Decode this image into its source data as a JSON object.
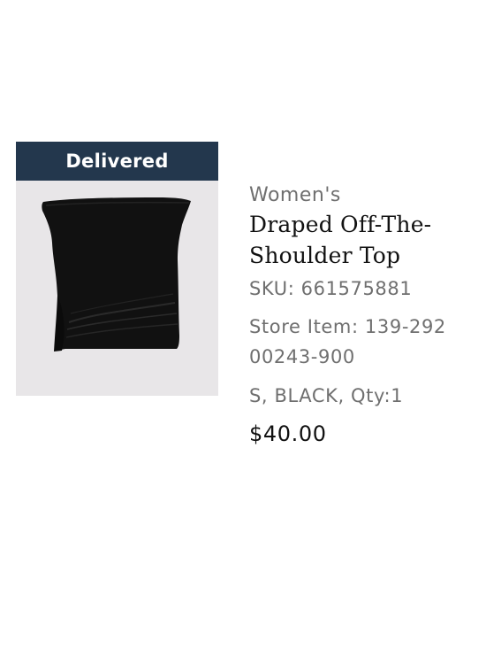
{
  "order_item": {
    "status": "Delivered",
    "category": "Women's",
    "product_name": "Draped Off-The-Shoulder Top",
    "sku": "SKU: 661575881",
    "store_item_line1": "Store Item: 139-292",
    "store_item_line2": "00243-900",
    "variant": "S, BLACK, Qty:1",
    "price": "$40.00"
  },
  "colors": {
    "status_banner_bg": "#23374d",
    "image_bg": "#e8e6e8",
    "garment": "#111111",
    "muted_text": "#6f6f6f",
    "primary_text": "#111111"
  }
}
